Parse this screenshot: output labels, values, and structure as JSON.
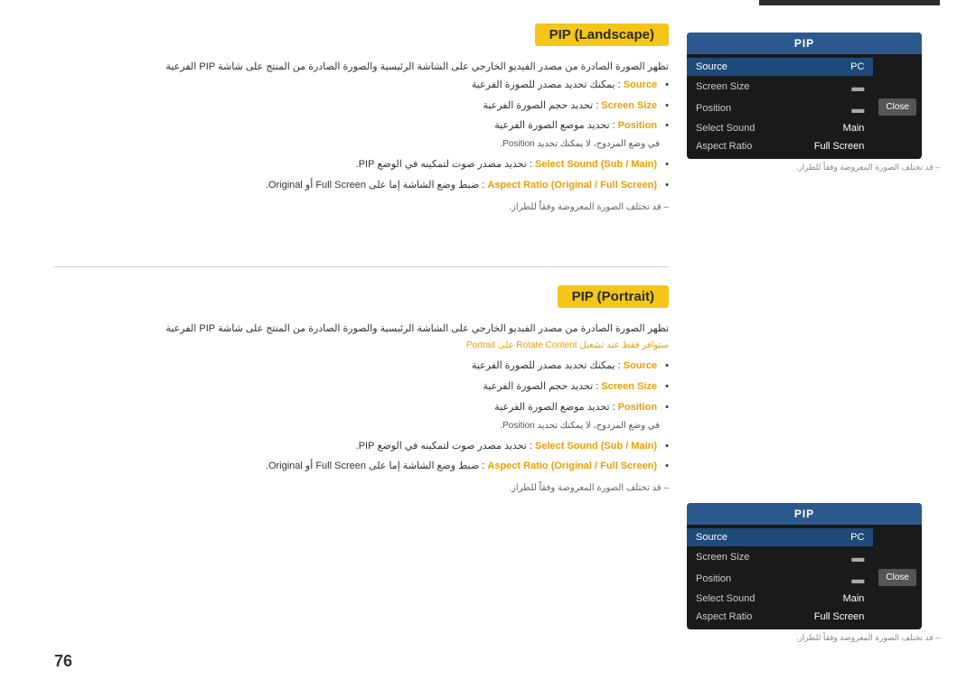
{
  "page": {
    "number": "76",
    "top_bar_color": "#2c2c2c"
  },
  "section1": {
    "title": "PIP (Landscape)",
    "arabic_main": "تظهر الصورة الصادرة من مصدر الفيديو الخارجي على الشاشة الرئيسية والصورة الصادرة من المنتج على شاشة PIP الفرعية",
    "bullet1_label": "Source",
    "bullet1_text": "يمكنك تحديد مصدر للصورة الفرعية",
    "bullet2_label": "Screen Size",
    "bullet2_text": "تحديد حجم الصورة الفرعية",
    "bullet3_label": "Position",
    "bullet3_text": "تحديد موضع الصورة الفرعية",
    "sub3_text": "في وضع المزدوج، لا يمكنك تحديد Position.",
    "bullet4_label": "(Sub / Main) Select Sound",
    "bullet4_text": "تحديد مصدر صوت لتمكينه في الوضع PIP.",
    "bullet5_label": "(Original / Full Screen) Aspect Ratio",
    "bullet5_text": "ضبط وضع الشاشة إما على Full Screen أو Original.",
    "footnote": "– قد تختلف الصورة المعروضة وفقاً للطراز.",
    "pip": {
      "title": "PIP",
      "source_label": "Source",
      "source_value": "PC",
      "screen_size_label": "Screen Size",
      "screen_size_icon": "▬",
      "position_label": "Position",
      "position_icon": "▬",
      "select_sound_label": "Select Sound",
      "select_sound_value": "Main",
      "aspect_ratio_label": "Aspect Ratio",
      "aspect_ratio_value": "Full Screen",
      "close_label": "Close"
    }
  },
  "section2": {
    "title": "PIP (Portrait)",
    "arabic_main": "تظهر الصورة الصادرة من مصدر الفيديو الخارجي على الشاشة الرئيسية والصورة الصادرة من المنتج على شاشة PIP الفرعية",
    "rotate_note": "ستوافر فقط عند تشغيل Rotate Content على Portrait",
    "bullet1_label": "Source",
    "bullet1_text": "يمكنك تحديد مصدر للصورة الفرعية",
    "bullet2_label": "Screen Size",
    "bullet2_text": "تحديد حجم الصورة الفرعية",
    "bullet3_label": "Position",
    "bullet3_text": "تحديد موضع الصورة الفرعية",
    "sub3_text": "في وضع المزدوج، لا يمكنك تحديد Position.",
    "bullet4_label": "(Sub / Main) Select Sound",
    "bullet4_text": "تحديد مصدر صوت لتمكينه في الوضع PIP.",
    "bullet5_label": "(Original / Full Screen) Aspect Ratio",
    "bullet5_text": "ضبط وضع الشاشة إما على Full Screen أو Original.",
    "footnote": "– قد تختلف الصورة المعروضة وفقاً للطراز.",
    "pip": {
      "title": "PIP",
      "source_label": "Source",
      "source_value": "PC",
      "screen_size_label": "Screen Size",
      "screen_size_icon": "▬",
      "position_label": "Position",
      "position_icon": "▬",
      "select_sound_label": "Select Sound",
      "select_sound_value": "Main",
      "aspect_ratio_label": "Aspect Ratio",
      "aspect_ratio_value": "Full Screen",
      "close_label": "Close"
    }
  }
}
